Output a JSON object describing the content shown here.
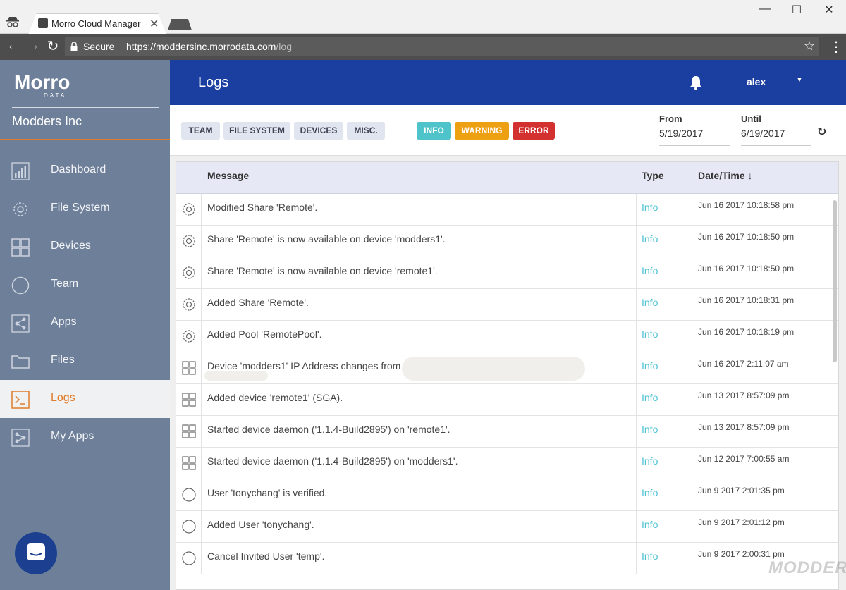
{
  "browser": {
    "tab_title": "Morro Cloud Manager",
    "secure_label": "Secure",
    "url_base": "https://moddersinc.morrodata.com",
    "url_path": "/log"
  },
  "sidebar": {
    "logo_text": "Morro",
    "logo_sub": "DATA",
    "org_name": "Modders Inc",
    "items": [
      {
        "label": "Dashboard",
        "icon": "chart-icon",
        "active": false
      },
      {
        "label": "File System",
        "icon": "gear-icon",
        "active": false
      },
      {
        "label": "Devices",
        "icon": "grid-icon",
        "active": false
      },
      {
        "label": "Team",
        "icon": "circle-icon",
        "active": false
      },
      {
        "label": "Apps",
        "icon": "share-icon",
        "active": false
      },
      {
        "label": "Files",
        "icon": "folder-icon",
        "active": false
      },
      {
        "label": "Logs",
        "icon": "terminal-icon",
        "active": true
      },
      {
        "label": "My Apps",
        "icon": "apps-icon",
        "active": false
      }
    ]
  },
  "header": {
    "title": "Logs",
    "user": "alex"
  },
  "filters": {
    "categories": [
      "TEAM",
      "FILE SYSTEM",
      "DEVICES",
      "MISC."
    ],
    "levels": [
      {
        "label": "INFO",
        "color": "#4ec3c9"
      },
      {
        "label": "WARNING",
        "color": "#eea013"
      },
      {
        "label": "ERROR",
        "color": "#d33030"
      }
    ],
    "from_label": "From",
    "from_value": "5/19/2017",
    "until_label": "Until",
    "until_value": "6/19/2017"
  },
  "table": {
    "columns": {
      "message": "Message",
      "type": "Type",
      "datetime": "Date/Time ↓"
    },
    "rows": [
      {
        "icon": "gear-icon",
        "message": "Modified Share 'Remote'.",
        "type": "Info",
        "datetime": "Jun 16 2017 10:18:58 pm"
      },
      {
        "icon": "gear-icon",
        "message": "Share 'Remote' is now available on device 'modders1'.",
        "type": "Info",
        "datetime": "Jun 16 2017 10:18:50 pm"
      },
      {
        "icon": "gear-icon",
        "message": "Share 'Remote' is now available on device 'remote1'.",
        "type": "Info",
        "datetime": "Jun 16 2017 10:18:50 pm"
      },
      {
        "icon": "gear-icon",
        "message": "Added Share 'Remote'.",
        "type": "Info",
        "datetime": "Jun 16 2017 10:18:31 pm"
      },
      {
        "icon": "gear-icon",
        "message": "Added Pool 'RemotePool'.",
        "type": "Info",
        "datetime": "Jun 16 2017 10:18:19 pm"
      },
      {
        "icon": "grid-icon",
        "message": "Device 'modders1' IP Address changes from '                                                               ' to",
        "type": "Info",
        "datetime": "Jun 16 2017 2:11:07 am",
        "redacted": true
      },
      {
        "icon": "grid-icon",
        "message": "Added device 'remote1' (SGA).",
        "type": "Info",
        "datetime": "Jun 13 2017 8:57:09 pm"
      },
      {
        "icon": "grid-icon",
        "message": "Started device daemon ('1.1.4-Build2895') on 'remote1'.",
        "type": "Info",
        "datetime": "Jun 13 2017 8:57:09 pm"
      },
      {
        "icon": "grid-icon",
        "message": "Started device daemon ('1.1.4-Build2895') on 'modders1'.",
        "type": "Info",
        "datetime": "Jun 12 2017 7:00:55 am"
      },
      {
        "icon": "circle-icon",
        "message": "User 'tonychang' is verified.",
        "type": "Info",
        "datetime": "Jun 9 2017 2:01:35 pm"
      },
      {
        "icon": "circle-icon",
        "message": "Added User 'tonychang'.",
        "type": "Info",
        "datetime": "Jun 9 2017 2:01:12 pm"
      },
      {
        "icon": "circle-icon",
        "message": "Cancel Invited User 'temp'.",
        "type": "Info",
        "datetime": "Jun 9 2017 2:00:31 pm"
      }
    ]
  },
  "watermark": "MODDERS"
}
